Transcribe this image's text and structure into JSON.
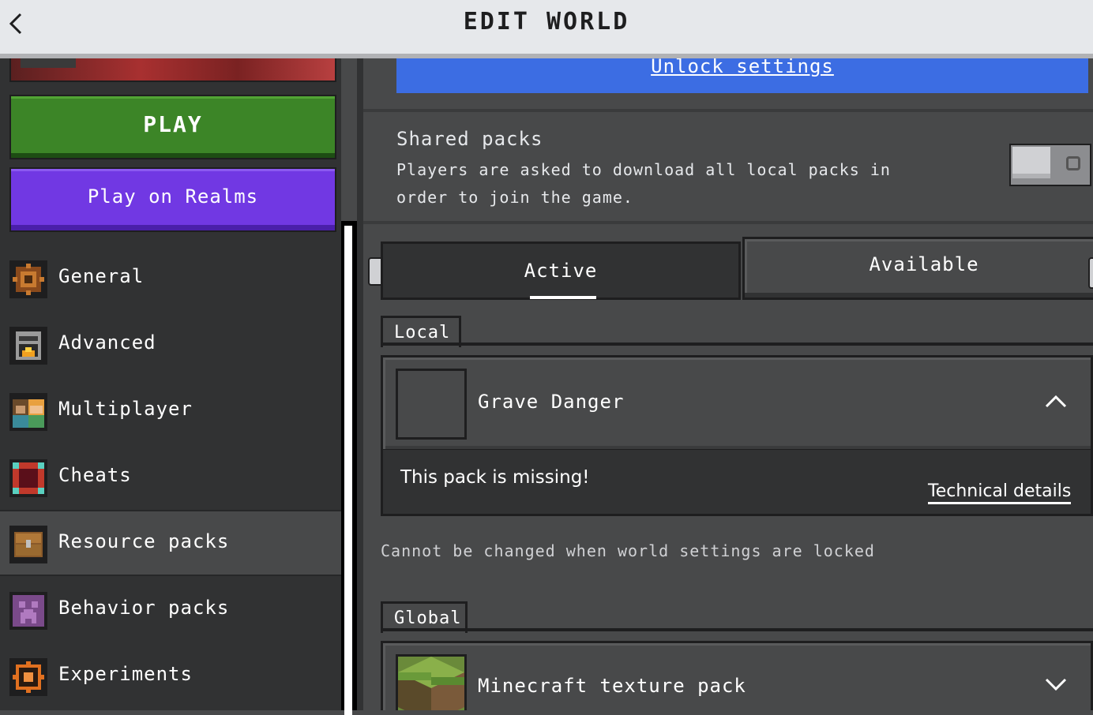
{
  "header": {
    "title": "EDIT WORLD"
  },
  "sidebar": {
    "play_label": "PLAY",
    "realms_label": "Play on Realms",
    "items": [
      {
        "label": "General",
        "icon": "gear-icon"
      },
      {
        "label": "Advanced",
        "icon": "furnace-icon"
      },
      {
        "label": "Multiplayer",
        "icon": "players-icon"
      },
      {
        "label": "Cheats",
        "icon": "cheats-icon"
      },
      {
        "label": "Resource packs",
        "icon": "chest-icon"
      },
      {
        "label": "Behavior packs",
        "icon": "creeper-icon"
      },
      {
        "label": "Experiments",
        "icon": "experiments-icon"
      }
    ],
    "selected_index": 4
  },
  "main": {
    "unlock_label": "Unlock settings",
    "shared_packs": {
      "title": "Shared packs",
      "description": "Players are asked to download all local packs in order to join the game.",
      "enabled": false
    },
    "tabs": [
      {
        "label": "Active",
        "selected": true
      },
      {
        "label": "Available",
        "selected": false
      }
    ],
    "key_hint": "[",
    "local": {
      "header": "Local",
      "pack_name": "Grave Danger",
      "missing_text": "This pack is missing!",
      "details_link": "Technical details"
    },
    "locked_note": "Cannot be changed when world settings are locked",
    "global": {
      "header": "Global",
      "pack_name": "Minecraft texture pack"
    }
  },
  "colors": {
    "play_green": "#3c8527",
    "realms_purple": "#7138e3",
    "unlock_blue": "#3c6de3",
    "panel_dark": "#313233",
    "panel_mid": "#48494a"
  }
}
